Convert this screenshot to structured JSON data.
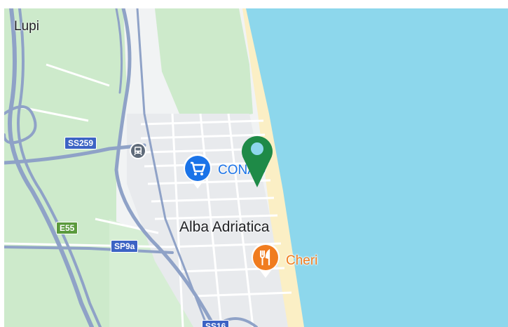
{
  "map": {
    "colors": {
      "sea": "#8dd7ec",
      "land": "#f1f3f4",
      "green": "#cdeacb",
      "road_major": "#8fa2c7",
      "road_minor": "#ffffff",
      "beach": "#fbefc5",
      "highway_shield": "#3c63c4",
      "european_shield": "#5a9a3c",
      "conad_blue": "#1a73e8",
      "cheri_orange": "#f07c1f",
      "marker_green": "#1e8a47"
    },
    "places": {
      "lupi": "Lupi",
      "alba": "Alba Adriatica"
    },
    "shields": {
      "ss259": "SS259",
      "e55": "E55",
      "sp9a": "SP9a",
      "ss16": "SS16"
    },
    "pois": {
      "conad": {
        "label": "CONAD",
        "icon": "shopping-cart-icon"
      },
      "cheri": {
        "label": "Cheri",
        "icon": "fork-knife-icon"
      },
      "station": {
        "icon": "train-icon"
      }
    },
    "marker": {
      "icon": "map-pin-icon"
    }
  }
}
